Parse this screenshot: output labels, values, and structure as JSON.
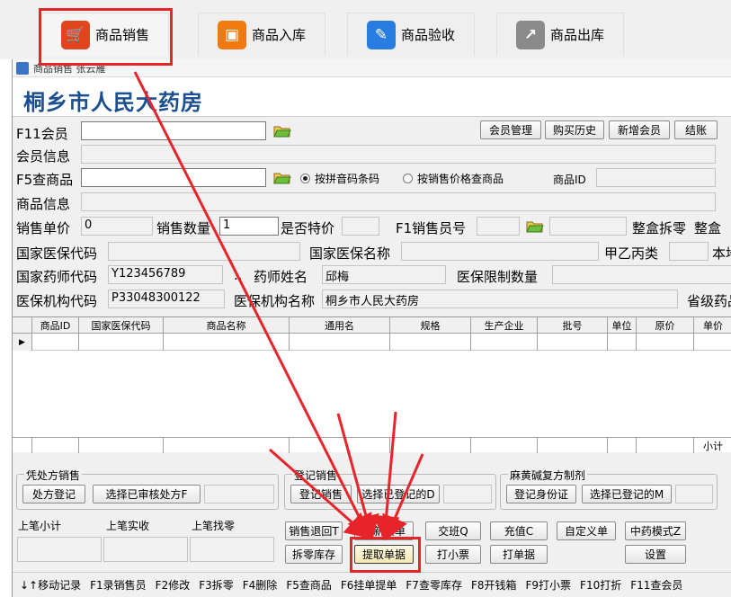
{
  "top_tabs": [
    {
      "label": "商品销售",
      "icon": "cart-icon",
      "color": "#e0451e"
    },
    {
      "label": "商品入库",
      "icon": "warehouse-icon",
      "color": "#f07a10"
    },
    {
      "label": "商品验收",
      "icon": "pen-icon",
      "color": "#2a7de0"
    },
    {
      "label": "商品出库",
      "icon": "chart-icon",
      "color": "#8a8a8a"
    }
  ],
  "window": {
    "title": "商品销售 张云雁",
    "pharmacy": "桐乡市人民大药房"
  },
  "member": {
    "label": "F11会员",
    "buttons": [
      "会员管理",
      "购买历史",
      "新增会员",
      "结账"
    ],
    "info_label": "会员信息"
  },
  "search": {
    "label": "F5查商品",
    "radio1": "按拼音码条码",
    "radio2": "按销售价格查商品",
    "id_label": "商品ID",
    "info_label": "商品信息"
  },
  "sale": {
    "price_label": "销售单价",
    "price": "0",
    "qty_label": "销售数量",
    "qty": "1",
    "special_label": "是否特价",
    "seller_label": "F1销售员号",
    "split_label": "整盒拆零",
    "box_label": "整盒"
  },
  "insurance": {
    "code_label": "国家医保代码",
    "name_label": "国家医保名称",
    "class_label": "甲乙丙类",
    "local_label": "本地",
    "pharmacist_code_label": "国家药师代码",
    "pharmacist_code": "Y123456789",
    "dots": "..",
    "pharmacist_name_label": "药师姓名",
    "pharmacist_name": "邱梅",
    "limit_label": "医保限制数量",
    "org_code_label": "医保机构代码",
    "org_code": "P33048300122",
    "org_name_label": "医保机构名称",
    "org_name": "桐乡市人民大药房",
    "province_label": "省级药品"
  },
  "grid": {
    "columns": [
      "商品ID",
      "国家医保代码",
      "商品名称",
      "通用名",
      "规格",
      "生产企业",
      "批号",
      "单位",
      "原价",
      "单价"
    ],
    "row_marker": "▶",
    "footer_label": "小计"
  },
  "groups": {
    "prescription": {
      "title": "凭处方销售",
      "btn1": "处方登记",
      "btn2": "选择已审核处方F"
    },
    "register": {
      "title": "登记销售",
      "btn1": "登记销售",
      "btn2": "选择已登记的D"
    },
    "ephedrine": {
      "title": "麻黄碱复方制剂",
      "btn1": "登记身份证",
      "btn2": "选择已登记的M"
    }
  },
  "summary": {
    "subtotal_label": "上笔小计",
    "received_label": "上笔实收",
    "change_label": "上笔找零"
  },
  "actions": {
    "row1": [
      "销售退回T",
      "重新录单",
      "交班Q",
      "充值C",
      "自定义单",
      "中药模式Z"
    ],
    "row2": [
      "拆零库存",
      "提取单据",
      "打小票",
      "打单据",
      "设置"
    ]
  },
  "status": [
    "↓↑移动记录",
    "F1录销售员",
    "F2修改",
    "F3拆零",
    "F4删除",
    "F5查商品",
    "F6挂单提单",
    "F7查零库存",
    "F8开钱箱",
    "F9打小票",
    "F10打折",
    "F11查会员"
  ],
  "colors": {
    "annotation_red": "#e8242b",
    "title_blue": "#1c4f92"
  }
}
